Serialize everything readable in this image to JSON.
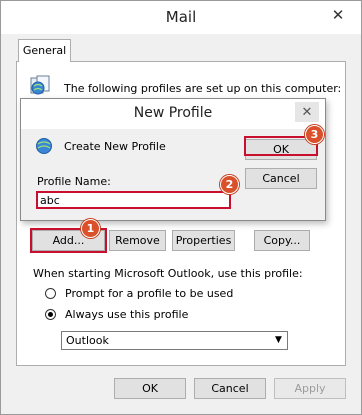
{
  "window": {
    "title": "Mail",
    "close_glyph": "✕"
  },
  "tabs": [
    {
      "label": "General"
    }
  ],
  "profiles": {
    "intro": "The following profiles are set up on this computer:",
    "buttons": {
      "add": "Add...",
      "remove": "Remove",
      "properties": "Properties",
      "copy": "Copy..."
    }
  },
  "startup": {
    "label": "When starting Microsoft Outlook, use this profile:",
    "options": [
      {
        "label": "Prompt for a profile to be used",
        "selected": false
      },
      {
        "label": "Always use this profile",
        "selected": true
      }
    ],
    "profile_select": {
      "value": "Outlook",
      "arrow_glyph": "▼"
    }
  },
  "footer": {
    "ok": "OK",
    "cancel": "Cancel",
    "apply": "Apply"
  },
  "dialog": {
    "title": "New Profile",
    "close_glyph": "✕",
    "heading": "Create New Profile",
    "name_label": "Profile Name:",
    "name_value": "abc",
    "ok": "OK",
    "cancel": "Cancel"
  },
  "callouts": [
    {
      "number": "1"
    },
    {
      "number": "2"
    },
    {
      "number": "3"
    }
  ],
  "colors": {
    "highlight": "#c8102e",
    "badge": "#d9502b",
    "dialog_bg": "#f0f0f0",
    "panel_bg": "#ffffff"
  },
  "icons": [
    "mail-profiles-icon",
    "new-profile-icon",
    "close-icon",
    "dropdown-arrow-icon"
  ]
}
